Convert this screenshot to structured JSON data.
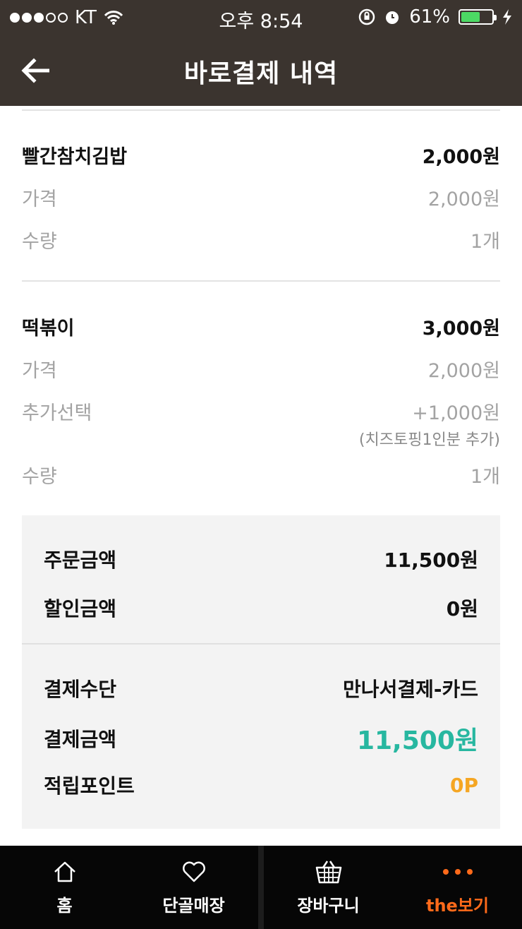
{
  "status_bar": {
    "carrier": "KT",
    "time": "오후 8:54",
    "battery": "61%",
    "battery_level": 0.61
  },
  "header": {
    "title": "바로결제 내역",
    "back_icon": "arrow-left-icon"
  },
  "items": [
    {
      "name": "빨간참치김밥",
      "total": "2,000원",
      "details": [
        {
          "label": "가격",
          "value": "2,000원"
        },
        {
          "label": "수량",
          "value": "1개"
        }
      ]
    },
    {
      "name": "떡볶이",
      "total": "3,000원",
      "details": [
        {
          "label": "가격",
          "value": "2,000원"
        },
        {
          "label": "추가선택",
          "value": "+1,000원",
          "note": "(치즈토핑1인분 추가)"
        },
        {
          "label": "수량",
          "value": "1개"
        }
      ]
    }
  ],
  "summary": {
    "order_label": "주문금액",
    "order_value": "11,500원",
    "discount_label": "할인금액",
    "discount_value": "0원",
    "method_label": "결제수단",
    "method_value": "만나서결제-카드",
    "paid_label": "결제금액",
    "paid_value": "11,500원",
    "points_label": "적립포인트",
    "points_value": "0P"
  },
  "tabbar": [
    {
      "label": "홈",
      "icon": "home-icon"
    },
    {
      "label": "단골매장",
      "icon": "heart-icon"
    },
    {
      "label": "장바구니",
      "icon": "basket-icon"
    },
    {
      "label": "the보기",
      "icon": "more-icon",
      "active": true
    }
  ],
  "colors": {
    "header_bg": "#3b342f",
    "accent_teal": "#27b7a0",
    "accent_orange": "#f5a623",
    "active_tab": "#ff6a1a"
  }
}
